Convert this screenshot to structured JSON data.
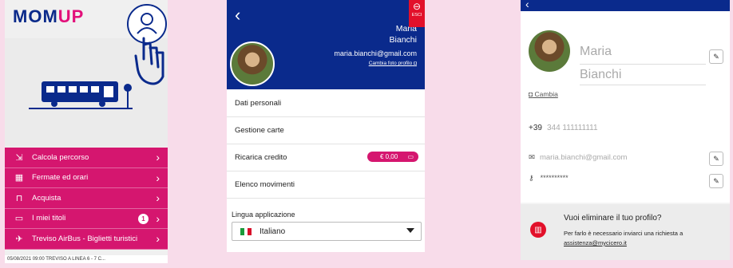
{
  "screen1": {
    "logo_part1": "MOM",
    "logo_part2": "UP",
    "menu": [
      {
        "icon": "route-icon",
        "label": "Calcola percorso"
      },
      {
        "icon": "calendar-icon",
        "label": "Fermate ed orari"
      },
      {
        "icon": "bag-icon",
        "label": "Acquista"
      },
      {
        "icon": "ticket-icon",
        "label": "I miei titoli",
        "badge": "1"
      },
      {
        "icon": "airbus-icon",
        "label": "Treviso AirBus - Biglietti turistici"
      }
    ],
    "ticker": "05/08/2021 09:00 TREVISO A LINEA 6 - 7 C..."
  },
  "screen2": {
    "first_name": "Maria",
    "last_name": "Bianchi",
    "email": "maria.bianchi@gmail.com",
    "change_photo": "Cambia foto profilo",
    "esc_label": "ESCI",
    "rows": [
      "Dati personali",
      "Gestione carte",
      "Ricarica credito",
      "Elenco movimenti"
    ],
    "credit_badge": "€ 0,00",
    "language_label": "Lingua applicazione",
    "language_value": "Italiano"
  },
  "screen3": {
    "first_name": "Maria",
    "last_name": "Bianchi",
    "change_label": "Cambia",
    "phone_prefix": "+39",
    "phone": "344 111111111",
    "email": "maria.bianchi@gmail.com",
    "password": "**********",
    "delete_title": "Vuoi eliminare il tuo profilo?",
    "delete_desc": "Per farlo è necessario inviarci una richiesta a",
    "delete_link": "assistenza@mycicero.it"
  },
  "colors": {
    "brand_blue": "#0a2a8c",
    "brand_pink": "#d5166f",
    "danger_red": "#e2102a"
  }
}
